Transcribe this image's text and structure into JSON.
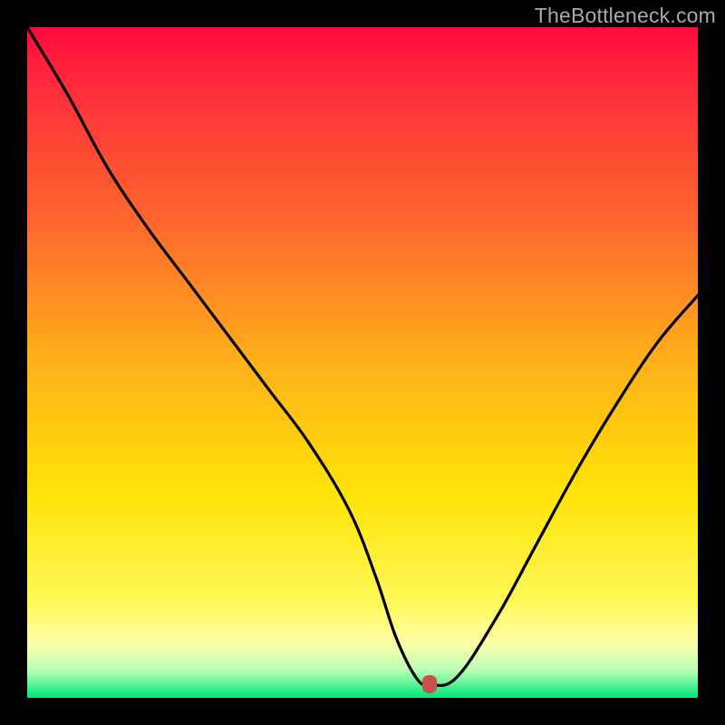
{
  "watermark": "TheBottleneck.com",
  "colors": {
    "frame": "#000000",
    "curve": "#000000",
    "marker": "#c6524b",
    "gradient_stops": [
      "#ff0a3c",
      "#ff2f3a",
      "#ff6a2c",
      "#ffb019",
      "#ffe408",
      "#fff85a",
      "#fdffa8",
      "#b6ffb6",
      "#00e676"
    ]
  },
  "chart_data": {
    "type": "line",
    "title": "",
    "xlabel": "",
    "ylabel": "",
    "xlim": [
      0,
      100
    ],
    "ylim": [
      0,
      100
    ],
    "legend": false,
    "grid": false,
    "series": [
      {
        "name": "bottleneck-curve",
        "x": [
          0,
          6,
          12,
          18,
          24,
          30,
          36,
          42,
          48,
          52,
          55,
          58,
          60,
          64,
          70,
          76,
          82,
          88,
          94,
          100
        ],
        "values": [
          100,
          90,
          79,
          70,
          62,
          54,
          46,
          38,
          28,
          18,
          9,
          3,
          2,
          3,
          12,
          23,
          34,
          44,
          53,
          60
        ]
      }
    ],
    "annotations": [
      {
        "name": "optimal-marker",
        "x": 60,
        "y": 2
      }
    ]
  }
}
